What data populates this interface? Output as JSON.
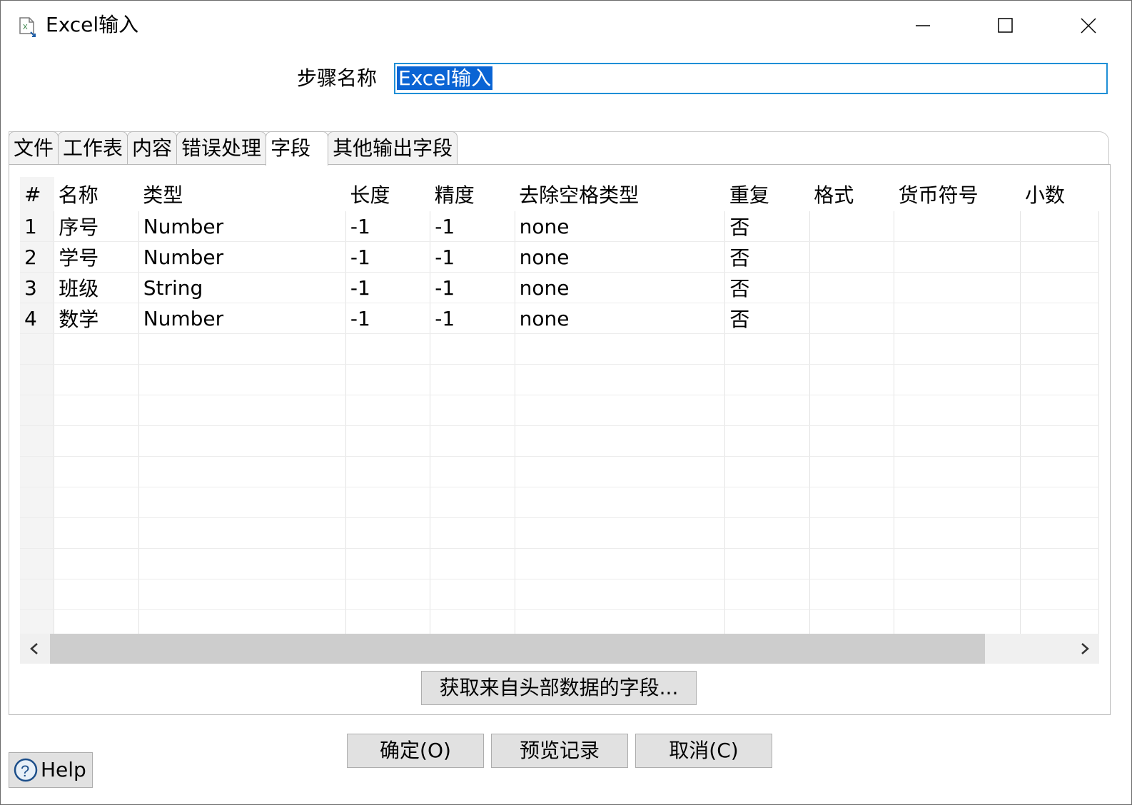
{
  "window": {
    "title": "Excel输入"
  },
  "icons": {
    "app": "excel-input-icon",
    "minimize": "minimize-icon",
    "maximize": "maximize-icon",
    "close": "close-icon",
    "help": "help-icon"
  },
  "step": {
    "label": "步骤名称",
    "value": "Excel输入"
  },
  "tabs": [
    {
      "label": "文件"
    },
    {
      "label": "工作表"
    },
    {
      "label": "内容"
    },
    {
      "label": "错误处理"
    },
    {
      "label": "字段"
    },
    {
      "label": "其他输出字段"
    }
  ],
  "active_tab": 4,
  "table": {
    "headers": [
      "#",
      "名称",
      "类型",
      "长度",
      "精度",
      "去除空格类型",
      "重复",
      "格式",
      "货币符号",
      "小数"
    ],
    "rows": [
      [
        "1",
        "序号",
        "Number",
        "-1",
        "-1",
        "none",
        "否",
        "",
        "",
        ""
      ],
      [
        "2",
        "学号",
        "Number",
        "-1",
        "-1",
        "none",
        "否",
        "",
        "",
        ""
      ],
      [
        "3",
        "班级",
        "String",
        "-1",
        "-1",
        "none",
        "否",
        "",
        "",
        ""
      ],
      [
        "4",
        "数学",
        "Number",
        "-1",
        "-1",
        "none",
        "否",
        "",
        "",
        ""
      ]
    ]
  },
  "buttons": {
    "get_fields": "获取来自头部数据的字段...",
    "ok": "确定(O)",
    "preview": "预览记录",
    "cancel": "取消(C)",
    "help": "Help"
  },
  "colors": {
    "selection": "#0a64d4",
    "input_focus_border": "#1f8fd6",
    "button_bg": "#e1e1e1"
  }
}
